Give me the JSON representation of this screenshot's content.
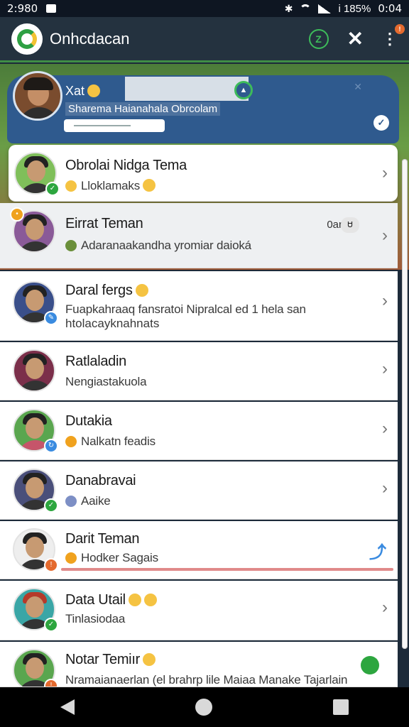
{
  "status_bar": {
    "time": "2:980",
    "battery_text": "i 185%",
    "clock": "0:04"
  },
  "app": {
    "title": "Onhcdacan"
  },
  "pinned": {
    "name": "Xat",
    "subtitle": "Sharema Haianahala Obrcolam"
  },
  "chats": [
    {
      "name": "Obrolai Nidga Tema",
      "message": "Lloklamaks",
      "status_color": "#2da63f",
      "status_icon": "check-icon",
      "style": "highlight"
    },
    {
      "name": "Eirrat Teman",
      "message": "Adaranaakandha yromiar daioká",
      "tag": "0ar",
      "tag_icon": "Ꮜ",
      "status_color": "#f0a21e",
      "status_icon": "clock-icon",
      "style": "grey"
    },
    {
      "name": "Daral fergs",
      "message": "Fuapkahraaq fansratoi Nipralcal ed 1 hela san",
      "message2": "htolacayknahnats",
      "status_color": "#3a8be0",
      "status_icon": "pencil-icon",
      "style": "normal"
    },
    {
      "name": "Ratlaladin",
      "message": "Nengiastakuola",
      "status_color": "",
      "status_icon": "",
      "style": "normal"
    },
    {
      "name": "Dutakia",
      "message": "Nalkatn feadis",
      "status_color": "#3a8be0",
      "status_icon": "refresh-icon",
      "style": "normal"
    },
    {
      "name": "Danabravai",
      "message": "Aaike",
      "status_color": "#2da63f",
      "status_icon": "check-icon",
      "style": "normal"
    },
    {
      "name": "Darit Teman",
      "message": "Hodker Sagais",
      "status_color": "#e46a2e",
      "status_icon": "alert-icon",
      "style": "active"
    },
    {
      "name": "Data Utail",
      "message": "Tinlasiodaa",
      "status_color": "#2da63f",
      "status_icon": "check-icon",
      "style": "normal"
    },
    {
      "name": "Notar Temiır",
      "message": "Nramaianaerlan (el brahrp lile Maiaa Manake Tajarlain",
      "status_color": "#e46a2e",
      "status_icon": "alert-icon",
      "style": "normal"
    }
  ],
  "colors": {
    "appbar": "#24323f",
    "pinned": "#2f5a8e",
    "accent_green": "#2da63f"
  }
}
